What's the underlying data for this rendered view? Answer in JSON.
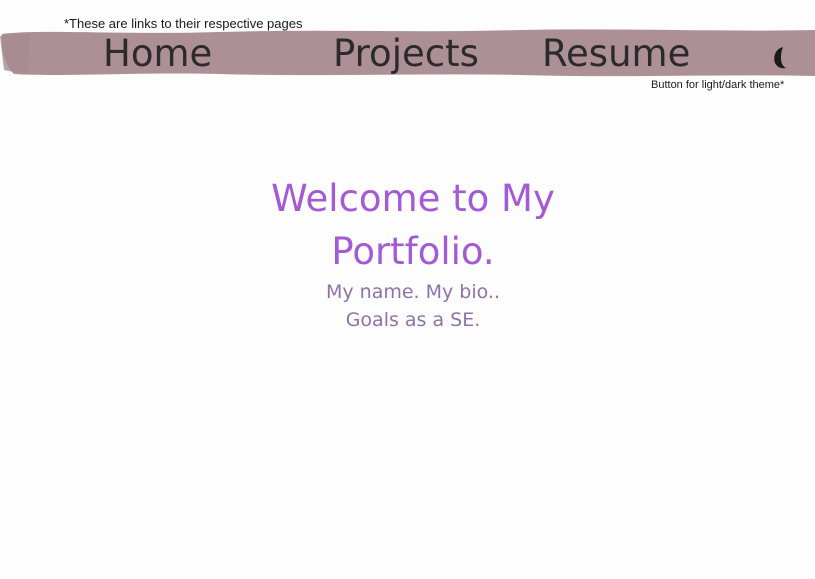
{
  "annotations": {
    "links_note": "*These are links to their respective pages",
    "theme_note": "Button for light/dark theme*"
  },
  "nav": {
    "items": [
      {
        "label": "Home"
      },
      {
        "label": "Projects"
      },
      {
        "label": "Resume"
      }
    ],
    "theme_button_icon": "moon-icon"
  },
  "hero": {
    "title_line1": "Welcome to My",
    "title_line2": "Portfolio.",
    "sub_line1": "My name. My bio..",
    "sub_line2": "Goals as a SE."
  },
  "colors": {
    "nav_brush": "#ad9095",
    "nav_text": "#2b2a2d",
    "title": "#a35ad7",
    "subtitle": "#8f72aa",
    "background": "#fdfdfd"
  }
}
